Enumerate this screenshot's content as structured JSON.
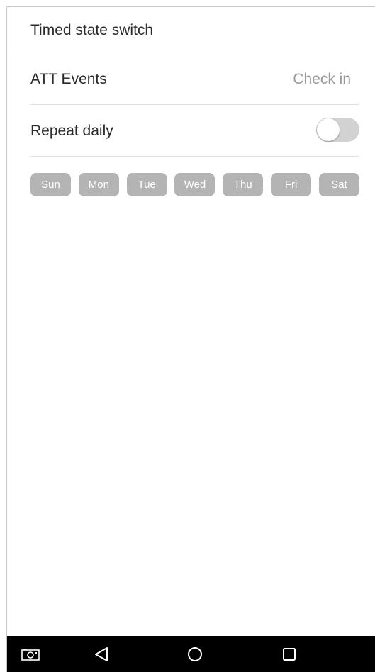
{
  "header": {
    "title": "Timed state switch"
  },
  "att_events": {
    "label": "ATT Events",
    "value": "Check in"
  },
  "repeat_daily": {
    "label": "Repeat daily",
    "enabled": false
  },
  "days": [
    {
      "label": "Sun",
      "selected": false
    },
    {
      "label": "Mon",
      "selected": false
    },
    {
      "label": "Tue",
      "selected": false
    },
    {
      "label": "Wed",
      "selected": false
    },
    {
      "label": "Thu",
      "selected": false
    },
    {
      "label": "Fri",
      "selected": false
    },
    {
      "label": "Sat",
      "selected": false
    }
  ],
  "navbar": {
    "icons": [
      "screenshot-icon",
      "back-icon",
      "home-icon",
      "recent-apps-icon"
    ]
  },
  "colors": {
    "day_chip_inactive": "#b4b4b4",
    "toggle_off_track": "#d2d2d2",
    "secondary_text": "#9a9a9a",
    "navbar": "#000000"
  }
}
